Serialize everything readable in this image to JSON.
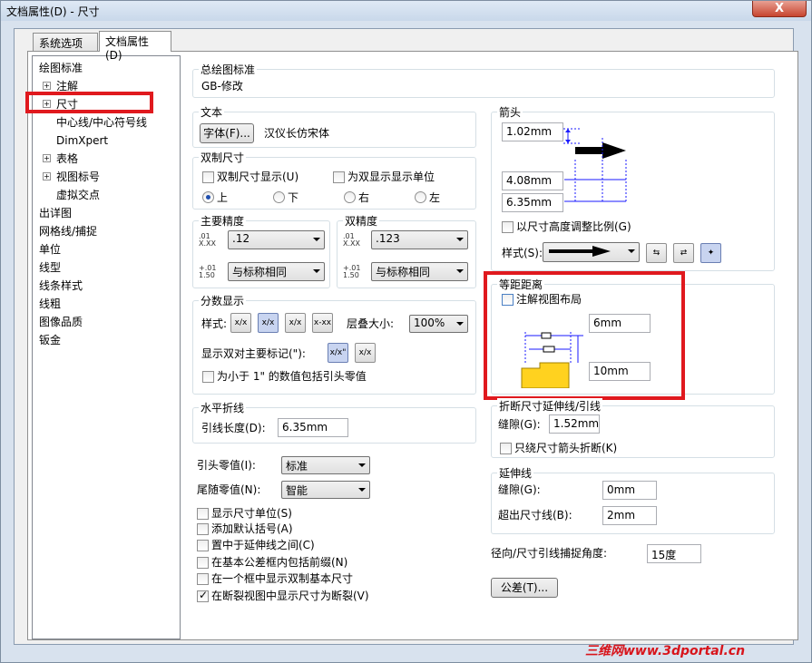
{
  "window": {
    "title": "文档属性(D) - 尺寸",
    "close_label": "X"
  },
  "tabs": [
    {
      "label": "系统选项(S)"
    },
    {
      "label": "文档属性(D)"
    }
  ],
  "tree": {
    "items": [
      {
        "label": "绘图标准"
      },
      {
        "label": "注解"
      },
      {
        "label": "尺寸"
      },
      {
        "label": "中心线/中心符号线"
      },
      {
        "label": "DimXpert"
      },
      {
        "label": "表格"
      },
      {
        "label": "视图标号"
      },
      {
        "label": "虚拟交点"
      },
      {
        "label": "出详图"
      },
      {
        "label": "网格线/捕捉"
      },
      {
        "label": "单位"
      },
      {
        "label": "线型"
      },
      {
        "label": "线条样式"
      },
      {
        "label": "线粗"
      },
      {
        "label": "图像品质"
      },
      {
        "label": "钣金"
      }
    ]
  },
  "standard": {
    "title": "总绘图标准",
    "value": "GB-修改"
  },
  "text": {
    "title": "文本",
    "font_button": "字体(F)...",
    "font_name": "汉仪长仿宋体"
  },
  "dual": {
    "title": "双制尺寸",
    "show_dual": "双制尺寸显示(U)",
    "show_units": "为双显示显示单位",
    "top": "上",
    "bottom": "下",
    "right": "右",
    "left": "左"
  },
  "primary_precision": {
    "title": "主要精度",
    "value1": ".12",
    "value2": "与标称相同",
    "icon1_top": ".01",
    "icon1_bot": "X.XX",
    "icon2_top": "+.01",
    "icon2_bot": "1.50"
  },
  "dual_precision": {
    "title": "双精度",
    "value1": ".123",
    "value2": "与标称相同",
    "icon1_top": ".01",
    "icon1_bot": "X.XX",
    "icon2_top": "+.01",
    "icon2_bot": "1.50"
  },
  "fraction": {
    "title": "分数显示",
    "style_label": "样式:",
    "stack_label": "层叠大小:",
    "stack_value": "100%",
    "dual_label": "显示双对主要标记(\"):",
    "lead_zero": "为小于 1\" 的数值包括引头零值",
    "icons": [
      "x/x",
      "x/x",
      "x/x",
      "x-xx"
    ]
  },
  "horizontal": {
    "title": "水平折线",
    "length_label": "引线长度(D):",
    "length_value": "6.35mm"
  },
  "leading_zero": {
    "label": "引头零值(I):",
    "value": "标准"
  },
  "trailing_zero": {
    "label": "尾随零值(N):",
    "value": "智能"
  },
  "options": [
    {
      "label": "显示尺寸单位(S)",
      "checked": false
    },
    {
      "label": "添加默认括号(A)",
      "checked": false
    },
    {
      "label": "置中于延伸线之间(C)",
      "checked": false
    },
    {
      "label": "在基本公差框内包括前缀(N)",
      "checked": false
    },
    {
      "label": "在一个框中显示双制基本尺寸",
      "checked": false
    },
    {
      "label": "在断裂视图中显示尺寸为断裂(V)",
      "checked": true
    }
  ],
  "arrows": {
    "title": "箭头",
    "size1": "1.02mm",
    "size2": "4.08mm",
    "size3": "6.35mm",
    "scale_label": "以尺寸高度调整比例(G)",
    "style_label": "样式(S):"
  },
  "offset": {
    "title": "等距距离",
    "layout_label": "注解视图布局",
    "dist1": "6mm",
    "dist2": "10mm"
  },
  "break": {
    "title": "折断尺寸延伸线/引线",
    "gap_label": "缝隙(G):",
    "gap_value": "1.52mm",
    "only_arrow": "只绕尺寸箭头折断(K)"
  },
  "extension": {
    "title": "延伸线",
    "gap_label": "缝隙(G):",
    "gap_value": "0mm",
    "beyond_label": "超出尺寸线(B):",
    "beyond_value": "2mm"
  },
  "snap": {
    "label": "径向/尺寸引线捕捉角度:",
    "value": "15度"
  },
  "tolerance_button": "公差(T)...",
  "watermark": "三维网www.3dportal.cn",
  "colors": {
    "highlight": "#e0191e",
    "accent": "#ffd21f"
  }
}
